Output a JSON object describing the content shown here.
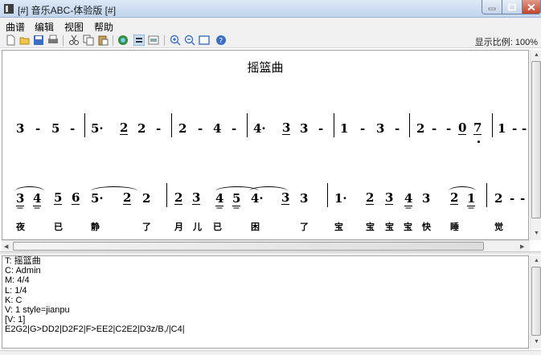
{
  "window": {
    "title": "[#] 音乐ABC-体验版 [#]"
  },
  "menu": {
    "items": [
      "曲谱",
      "编辑",
      "视图",
      "帮助"
    ]
  },
  "toolbar": {
    "icons": [
      "new-file-icon",
      "open-folder-icon",
      "save-icon",
      "print-icon",
      "cut-icon",
      "copy-icon",
      "paste-icon",
      "globe-icon",
      "view-mode-icon",
      "layout-icon",
      "zoom-in-icon",
      "zoom-out-icon",
      "fit-page-icon",
      "help-icon"
    ],
    "zoom_label": "显示比例: 100%"
  },
  "score": {
    "title": "摇篮曲",
    "row1": [
      "3",
      "-",
      "5",
      "-",
      "5·",
      "2",
      "2",
      "-",
      "2",
      "-",
      "4",
      "-",
      "4·",
      "3",
      "3",
      "-",
      "1",
      "-",
      "3",
      "-",
      "2",
      "-",
      "-",
      "0",
      "7",
      "1",
      "-",
      "-"
    ],
    "row2": [
      "3",
      "4",
      "5",
      "6",
      "5·",
      "2",
      "2",
      "2",
      "3",
      "4",
      "5",
      "4·",
      "3",
      "3",
      "1·",
      "2",
      "3",
      "4",
      "3",
      "2",
      "1",
      "2",
      "-",
      "-"
    ],
    "lyrics": [
      "夜",
      "已",
      "静",
      "了",
      "月",
      "儿",
      "已",
      "困",
      "了",
      "宝",
      "宝",
      "宝",
      "宝",
      "快",
      "睡",
      "觉"
    ]
  },
  "editor": {
    "lines": [
      "T: 摇篮曲",
      "C: Admin",
      "M: 4/4",
      "L: 1/4",
      "K: C",
      "V: 1 style=jianpu",
      "[V: 1]",
      "E2G2|G>DD2|D2F2|F>EE2|C2E2|D3z/B,/|C4|"
    ]
  }
}
